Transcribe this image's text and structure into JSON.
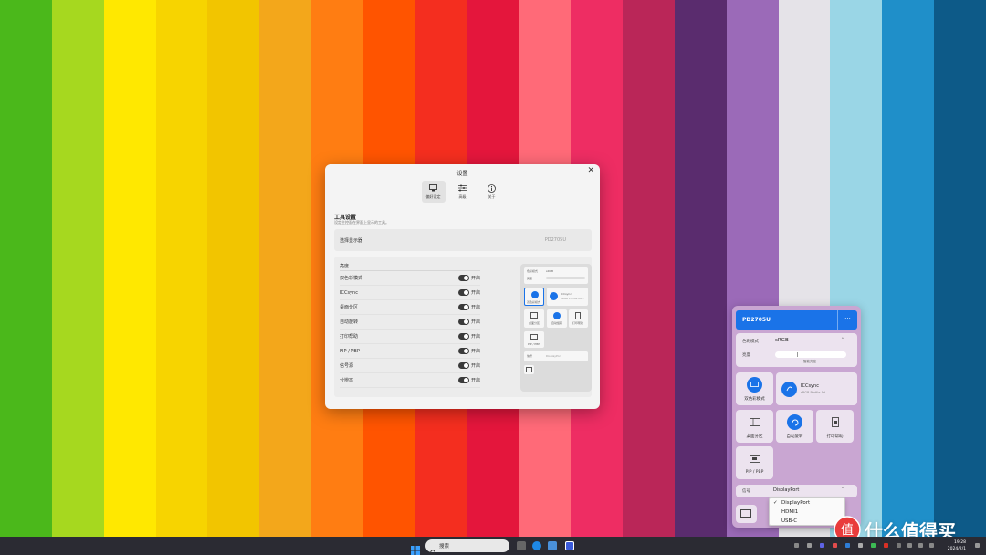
{
  "wallpaper": {
    "stripes": [
      "#4bb81b",
      "#a6d81f",
      "#ffe800",
      "#f7d400",
      "#f2c500",
      "#f3a71b",
      "#ff7d12",
      "#ff5400",
      "#f42e1f",
      "#e4163c",
      "#ff6a78",
      "#ee2d63",
      "#ba2658",
      "#5a2c6e",
      "#9b6ab8",
      "#e5e3e8",
      "#9ad6e6",
      "#1f8fc9",
      "#0d5a88"
    ]
  },
  "settings": {
    "title": "设置",
    "close_icon": "close-icon",
    "tabs": [
      {
        "label": "偏好设定",
        "icon": "monitor-icon",
        "active": true
      },
      {
        "label": "高级",
        "icon": "sliders-icon",
        "active": false
      },
      {
        "label": "关于",
        "icon": "info-icon",
        "active": false
      }
    ],
    "section_title": "工具设置",
    "section_desc": "设定主控面在界面上显示的工具。",
    "monitor_select_label": "选择显示器",
    "monitor_select_value": "PD2705U",
    "brightness_label": "亮度",
    "tools": [
      {
        "name": "双色彩模式",
        "state": "开启"
      },
      {
        "name": "ICCsync",
        "state": "开启"
      },
      {
        "name": "桌面分区",
        "state": "开启"
      },
      {
        "name": "自动旋转",
        "state": "开启"
      },
      {
        "name": "打印帮助",
        "state": "开启"
      },
      {
        "name": "PIP / PBP",
        "state": "开启"
      },
      {
        "name": "信号源",
        "state": "开启"
      },
      {
        "name": "分辨率",
        "state": "开启"
      }
    ],
    "preview": {
      "color_mode_label": "色彩模式",
      "color_mode_value": "sRGB",
      "brightness_label": "亮度",
      "tile_dual": "双色彩模式",
      "tile_iccsync": "ICCsync",
      "tile_iccsync_sub": "sRGB Profile Ad...",
      "tile_partition": "桌面分区",
      "tile_rotate": "自动旋转",
      "tile_print": "打印帮助",
      "tile_pip": "PIP / PBP",
      "signal_label": "信号",
      "signal_value": "DisplayPort"
    }
  },
  "flyout": {
    "monitor_name": "PD2705U",
    "more_label": "···",
    "color_mode_label": "色彩模式",
    "color_mode_value": "sRGB",
    "brightness_label": "亮度",
    "brightness_sub": "智能亮度",
    "tiles": {
      "dual_color": "双色彩模式",
      "iccsync_title": "ICCsync",
      "iccsync_sub": "sRGB Profile Ad...",
      "partition": "桌面分区",
      "rotate": "自动旋转",
      "print": "打印帮助",
      "pip": "PIP / PBP"
    },
    "signal_label": "信号",
    "signal_value": "DisplayPort",
    "signal_options": [
      "DisplayPort",
      "HDMI1",
      "USB-C"
    ],
    "signal_selected": "DisplayPort"
  },
  "taskbar": {
    "search_placeholder": "搜索",
    "time": "19:28",
    "date": "2024/2/1"
  },
  "watermark": {
    "text": "什么值得买",
    "logo": "值"
  }
}
